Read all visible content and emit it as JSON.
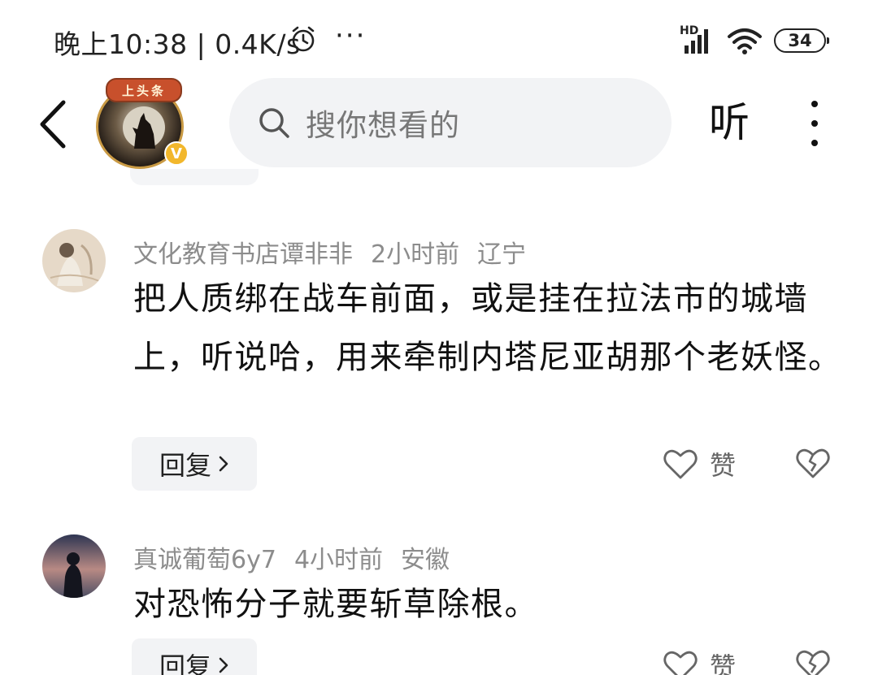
{
  "status_bar": {
    "time_text": "晚上10:38 | 0.4K/s",
    "dots": "···",
    "network_type": "HD",
    "battery_level": "34"
  },
  "header": {
    "channel_banner": "上头条",
    "verified_mark": "V",
    "search_placeholder": "搜你想看的",
    "listen_label": "听"
  },
  "comments": [
    {
      "author": "文化教育书店谭非非",
      "time": "2小时前",
      "location": "辽宁",
      "text": "把人质绑在战车前面，或是挂在拉法市的城墙上，听说哈，用来牵制内塔尼亚胡那个老妖怪。",
      "reply_label": "回复",
      "like_label": "赞"
    },
    {
      "author": "真诚葡萄6y7",
      "time": "4小时前",
      "location": "安徽",
      "text": "对恐怖分子就要斩草除根。",
      "reply_label": "回复",
      "like_label": "赞"
    }
  ],
  "colors": {
    "meta_gray": "#8c8c8c",
    "pill_bg": "#f2f3f5",
    "badge_gold": "#f2b72c",
    "banner_red": "#c8502c"
  },
  "icons": [
    "back-arrow-icon",
    "alarm-icon",
    "signal-icon",
    "wifi-icon",
    "search-icon",
    "more-icon",
    "heart-icon",
    "broken-heart-icon",
    "chevron-right-icon"
  ]
}
